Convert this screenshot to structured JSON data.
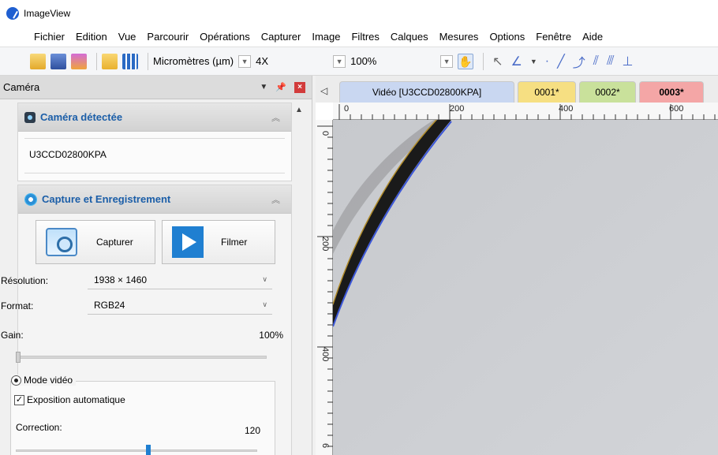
{
  "window": {
    "title": "ImageView"
  },
  "menu": [
    "Fichier",
    "Edition",
    "Vue",
    "Parcourir",
    "Opérations",
    "Capturer",
    "Image",
    "Filtres",
    "Calques",
    "Mesures",
    "Options",
    "Fenêtre",
    "Aide"
  ],
  "toolbar": {
    "unit": "Micromètres (µm)",
    "magnification": "4X",
    "zoom": "100%"
  },
  "panel": {
    "title": "Caméra",
    "camera_section": {
      "title": "Caméra détectée",
      "device": "U3CCD02800KPA"
    },
    "capture_section": {
      "title": "Capture et Enregistrement",
      "capture_label": "Capturer",
      "film_label": "Filmer",
      "resolution_label": "Résolution:",
      "resolution_value": "1938 × 1460",
      "format_label": "Format:",
      "format_value": "RGB24",
      "gain_label": "Gain:",
      "gain_value": "100%",
      "gain_level": 0.0,
      "video_mode_label": "Mode vidéo",
      "auto_exposure_label": "Exposition automatique",
      "correction_label": "Correction:",
      "correction_value": "120",
      "correction_level": 0.55
    }
  },
  "tabs": [
    {
      "label": "Vidéo [U3CCD02800KPA]",
      "color": "#c9d7f1",
      "active": false
    },
    {
      "label": "0001*",
      "color": "#f6df82",
      "active": false
    },
    {
      "label": "0002*",
      "color": "#c9e19b",
      "active": false
    },
    {
      "label": "0003*",
      "color": "#f4a6a6",
      "active": true
    }
  ],
  "rulers": {
    "horizontal": [
      "0",
      "200",
      "400",
      "600"
    ],
    "vertical": [
      "0",
      "200",
      "400",
      "6"
    ]
  },
  "colors": {
    "accent": "#1b5ea8",
    "selected_tab": "#f4a6a6"
  }
}
